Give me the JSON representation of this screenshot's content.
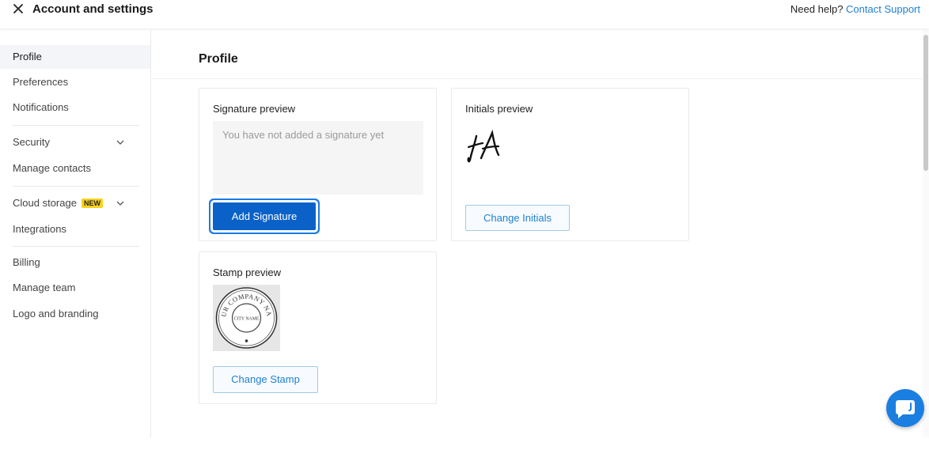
{
  "header": {
    "title": "Account and settings",
    "help_text": "Need help?",
    "help_link": "Contact Support"
  },
  "sidebar": {
    "items": [
      {
        "label": "Profile",
        "active": true
      },
      {
        "label": "Preferences"
      },
      {
        "label": "Notifications"
      },
      {
        "label": "Security",
        "has_chevron": true
      },
      {
        "label": "Manage contacts"
      },
      {
        "label": "Cloud storage",
        "badge": "NEW",
        "has_chevron": true
      },
      {
        "label": "Integrations"
      },
      {
        "label": "Billing"
      },
      {
        "label": "Manage team"
      },
      {
        "label": "Logo and branding"
      }
    ]
  },
  "main": {
    "title": "Profile",
    "signature": {
      "label": "Signature preview",
      "placeholder": "You have not added a signature yet",
      "button": "Add Signature"
    },
    "initials": {
      "label": "Initials preview",
      "button": "Change Initials"
    },
    "stamp": {
      "label": "Stamp preview",
      "image_text_top": "YOUR COMPANY NAME",
      "image_text_center": "CITY NAME",
      "button": "Change Stamp"
    }
  },
  "colors": {
    "primary": "#0a62c9",
    "link": "#1f7fd0",
    "badge": "#f7d21d",
    "chat": "#1a7fe0"
  },
  "icons": [
    "close-icon",
    "chevron-down-icon",
    "chat-icon"
  ]
}
